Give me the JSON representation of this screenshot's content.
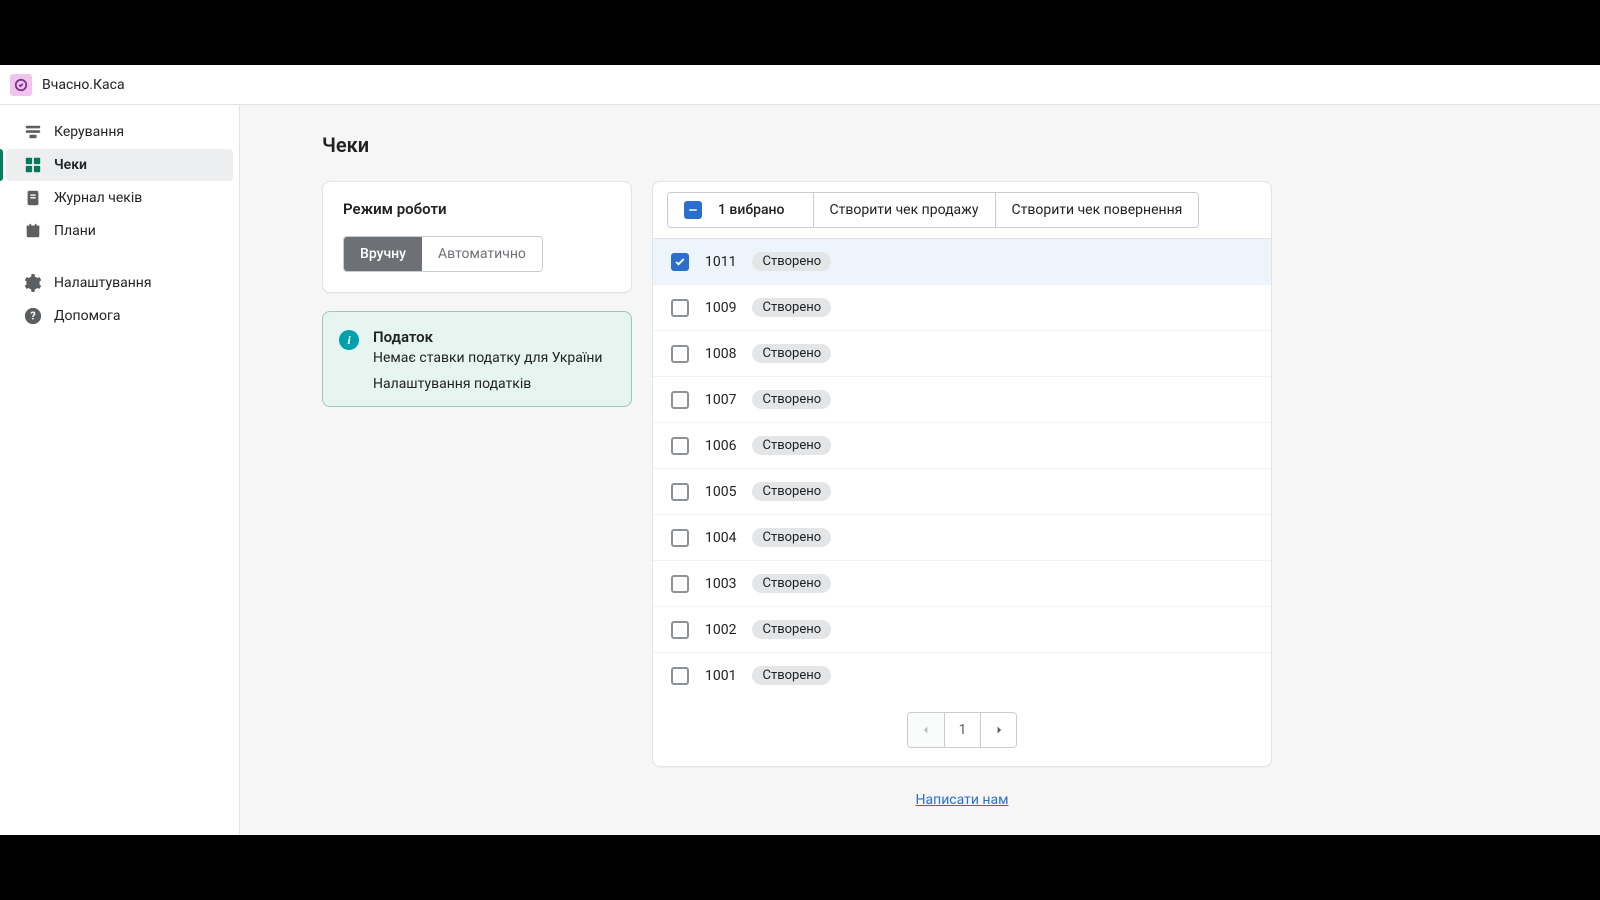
{
  "app_name": "Вчасно.Каса",
  "page_title": "Чеки",
  "sidebar": {
    "items": [
      {
        "label": "Керування",
        "icon": "manage"
      },
      {
        "label": "Чеки",
        "icon": "checks",
        "active": true
      },
      {
        "label": "Журнал чеків",
        "icon": "journal"
      },
      {
        "label": "Плани",
        "icon": "plans"
      }
    ],
    "items2": [
      {
        "label": "Налаштування",
        "icon": "settings"
      },
      {
        "label": "Допомога",
        "icon": "help"
      }
    ]
  },
  "mode_card": {
    "title": "Режим роботи",
    "manual": "Вручну",
    "auto": "Автоматично"
  },
  "info": {
    "title": "Податок",
    "text": "Немає ставки податку для України",
    "link": "Налаштування податків"
  },
  "list": {
    "selected_label": "1 вибрано",
    "action_sale": "Створити чек продажу",
    "action_return": "Створити чек повернення",
    "status": "Створено",
    "rows": [
      {
        "id": "1011",
        "selected": true
      },
      {
        "id": "1009",
        "selected": false
      },
      {
        "id": "1008",
        "selected": false
      },
      {
        "id": "1007",
        "selected": false
      },
      {
        "id": "1006",
        "selected": false
      },
      {
        "id": "1005",
        "selected": false
      },
      {
        "id": "1004",
        "selected": false
      },
      {
        "id": "1003",
        "selected": false
      },
      {
        "id": "1002",
        "selected": false
      },
      {
        "id": "1001",
        "selected": false
      }
    ],
    "page": "1"
  },
  "footer_link": "Написати нам"
}
